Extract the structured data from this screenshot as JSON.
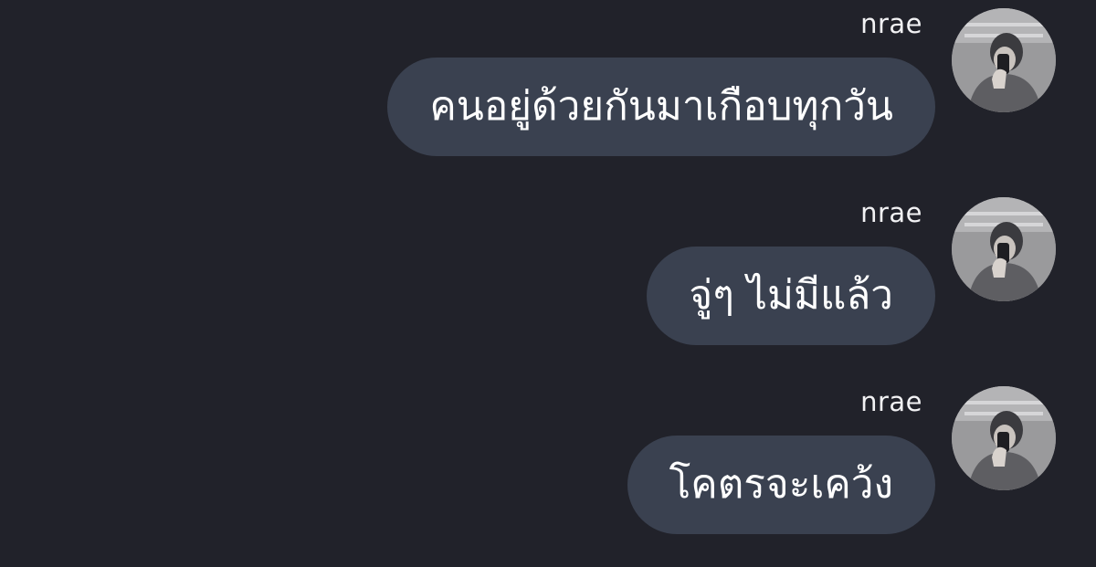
{
  "messages": [
    {
      "sender": "nrae",
      "text": "คนอยู่ด้วยกันมาเกือบทุกวัน"
    },
    {
      "sender": "nrae",
      "text": "จู่ๆ ไม่มีแล้ว"
    },
    {
      "sender": "nrae",
      "text": "โคตรจะเคว้ง"
    }
  ],
  "colors": {
    "background": "#21222a",
    "bubble": "#3a4150",
    "text": "#ffffff"
  }
}
